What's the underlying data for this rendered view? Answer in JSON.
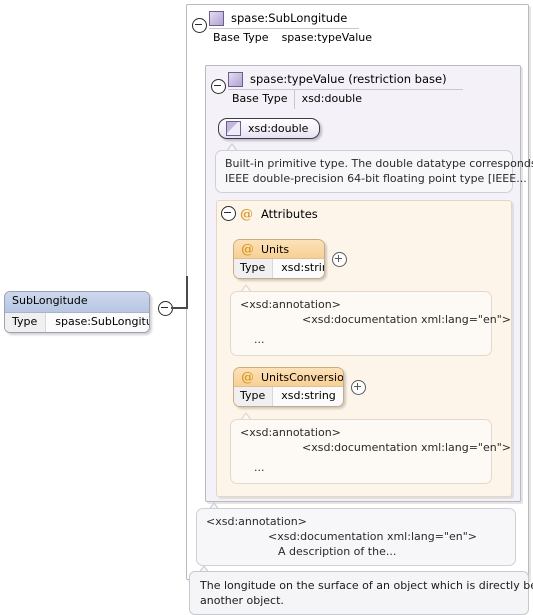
{
  "diagram": {
    "kind": "xsd-schema-documentation",
    "element_box": {
      "name": "SubLongitude",
      "type_key": "Type",
      "type_value": "spase:SubLongitude",
      "toggle": "collapse-minus-icon"
    },
    "outer_type": {
      "icon": "complex-type-icon",
      "title": "spase:SubLongitude",
      "base_type_key": "Base Type",
      "base_type_value": "spase:typeValue",
      "toggle": "collapse-minus-icon"
    },
    "restriction_type": {
      "icon": "complex-type-icon",
      "title": "spase:typeValue (restriction base)",
      "base_type_key": "Base Type",
      "base_type_value": "xsd:double",
      "toggle": "collapse-minus-icon"
    },
    "base_capsule": {
      "icon": "builtin-type-icon",
      "label": "xsd:double"
    },
    "base_doc": {
      "line1": "Built-in primitive type. The double datatype corresponds to",
      "line2": "IEEE double-precision 64-bit floating point type [IEEE..."
    },
    "attributes_group": {
      "icon": "at-sign-icon",
      "label": "Attributes",
      "toggle": "collapse-minus-icon",
      "items": [
        {
          "icon": "at-sign-icon",
          "name": "Units",
          "type_key": "Type",
          "type_value": "xsd:string",
          "toggle": "expand-plus-icon",
          "annotation": {
            "line1": "<xsd:annotation>",
            "line2": "<xsd:documentation xml:lang=\"en\">",
            "line3": "..."
          }
        },
        {
          "icon": "at-sign-icon",
          "name": "UnitsConversion",
          "type_key": "Type",
          "type_value": "xsd:string",
          "toggle": "expand-plus-icon",
          "annotation": {
            "line1": "<xsd:annotation>",
            "line2": "<xsd:documentation xml:lang=\"en\">",
            "line3": "..."
          }
        }
      ]
    },
    "type_annotation": {
      "line1": "<xsd:annotation>",
      "line2": "<xsd:documentation xml:lang=\"en\">",
      "line3": "A description of the..."
    },
    "description": {
      "line1": "The longitude on the surface of an object which is directly below",
      "line2": "another object."
    },
    "colors": {
      "canvas": "#ffffff",
      "panel_border": "#b9b9bf",
      "panel_inner_fill": "#f4f2f8",
      "attributes_fill": "#fdf5ea",
      "attributes_border": "#e3d6c2",
      "attr_header_gradient_top": "#fde2b8",
      "attr_header_gradient_bottom": "#f8d096",
      "element_header_gradient_top": "#cdd8ec",
      "element_header_gradient_bottom": "#b8c6e2",
      "type_icon_fill": "#c7bbe0",
      "at_sign": "#d89b2c",
      "bubble_fill": "#f7f7f9",
      "connector": "#4a4a4a"
    }
  }
}
